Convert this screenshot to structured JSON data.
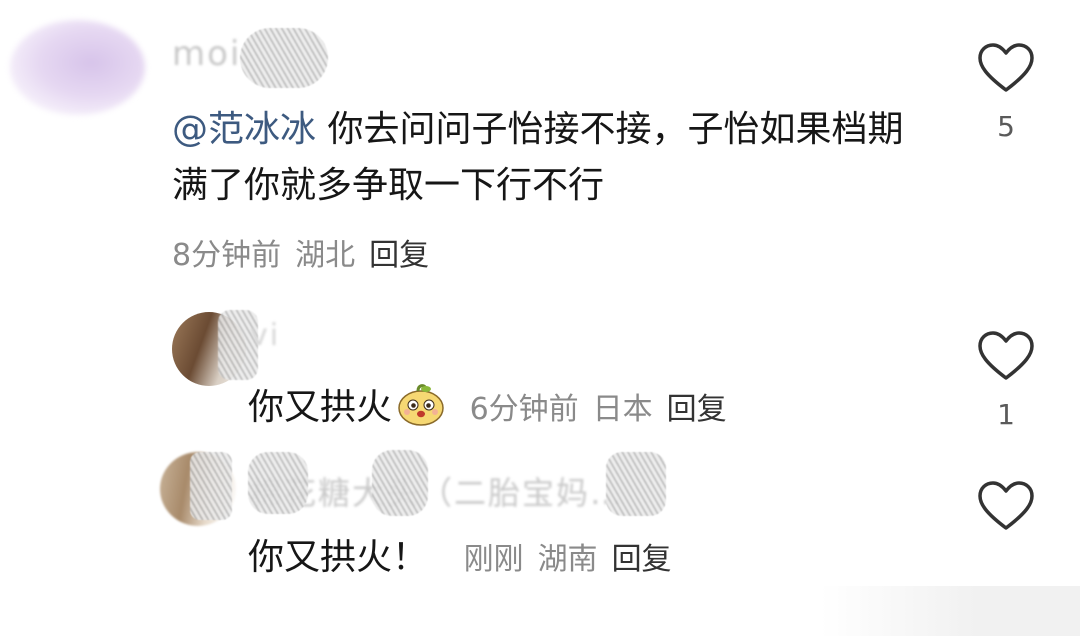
{
  "comments": [
    {
      "name_hint": "moi",
      "mention": "@范冰冰",
      "text": " 你去问问子怡接不接，子怡如果档期满了你就多争取一下行不行",
      "time": "8分钟前",
      "location": "湖北",
      "reply_label": "回复",
      "likes": "5"
    },
    {
      "name_hint": "vi",
      "text": "你又拱火",
      "emoji_icon": "bun-emoji-icon",
      "time": "6分钟前",
      "location": "日本",
      "reply_label": "回复",
      "likes": "1"
    },
    {
      "name_hint": "棉花糖大头（二胎宝妈…",
      "text": "你又拱火！",
      "time": "刚刚",
      "location": "湖南",
      "reply_label": "回复",
      "likes": ""
    }
  ],
  "colors": {
    "mention": "#3d5a80",
    "meta": "#8a8a8a",
    "heart_outline": "#333333"
  },
  "icons": {
    "like": "heart-outline-icon"
  }
}
